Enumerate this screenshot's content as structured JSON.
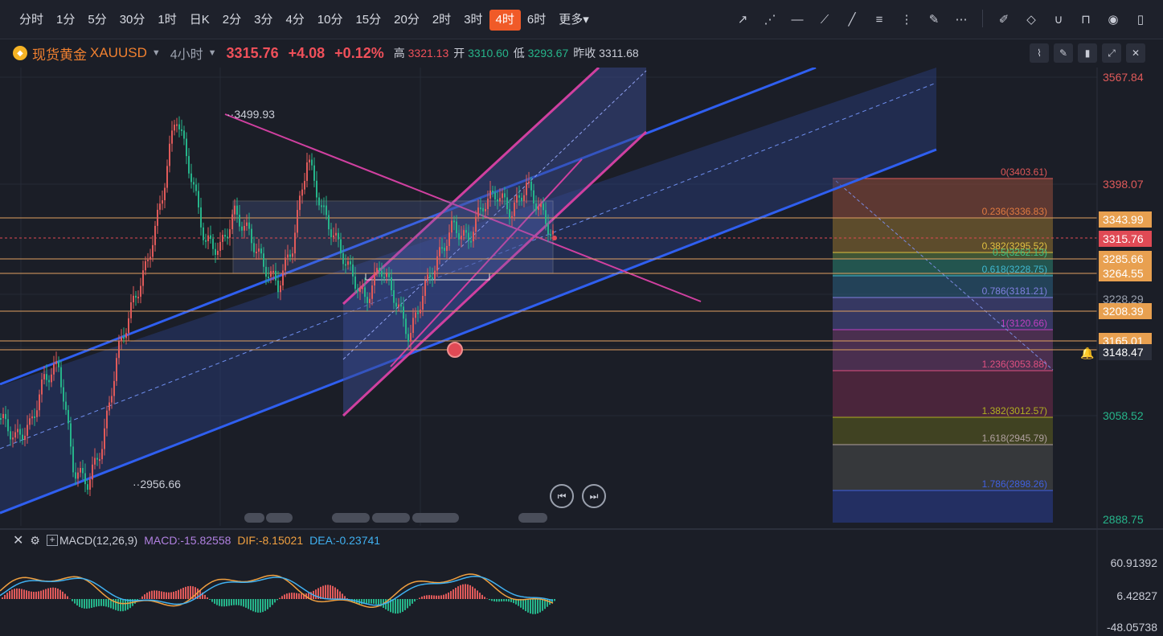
{
  "toolbar": {
    "periods": [
      "分时",
      "1分",
      "5分",
      "30分",
      "1时",
      "日K",
      "2分",
      "3分",
      "4分",
      "10分",
      "15分",
      "20分",
      "2时",
      "3时",
      "4时",
      "6时",
      "更多"
    ],
    "active_period": "4时",
    "more_caret": "▾"
  },
  "info": {
    "instrument": "现货黄金",
    "symbol": "XAUUSD",
    "timeframe": "4小时",
    "price": "3315.76",
    "change": "+4.08",
    "change_pct": "+0.12%",
    "high_label": "高",
    "high": "3321.13",
    "open_label": "开",
    "open": "3310.60",
    "low_label": "低",
    "low": "3293.67",
    "prev_label": "昨收",
    "prev": "3311.68"
  },
  "price_axis": {
    "ticks": [
      "3567.84",
      "3398.07",
      "3228.29",
      "3058.52",
      "2888.75"
    ],
    "tags": [
      {
        "label": "3343.99",
        "color": "#e8a050"
      },
      {
        "label": "3315.76",
        "color": "#e04a55"
      },
      {
        "label": "3285.66",
        "color": "#e8a050"
      },
      {
        "label": "3264.55",
        "color": "#e8a050"
      },
      {
        "label": "3208.39",
        "color": "#e8a050"
      },
      {
        "label": "3165.01",
        "color": "#e8a050"
      },
      {
        "label": "3148.47",
        "color": "#2b2f3b"
      }
    ]
  },
  "annotations": {
    "high_mark": "3499.93",
    "low_mark": "2956.66"
  },
  "fibonacci": [
    {
      "label": "0(3403.61)",
      "color": "#e05858"
    },
    {
      "label": "0.236(3336.83)",
      "color": "#e07a40"
    },
    {
      "label": "0.382(3295.52)",
      "color": "#e0c040"
    },
    {
      "label": "0.5(3262.13)",
      "color": "#40c080"
    },
    {
      "label": "0.618(3228.75)",
      "color": "#40b8d0"
    },
    {
      "label": "0.786(3181.21)",
      "color": "#8080e0"
    },
    {
      "label": "1(3120.66)",
      "color": "#c040c0"
    },
    {
      "label": "1.236(3053.88)",
      "color": "#e05080"
    },
    {
      "label": "1.382(3012.57)",
      "color": "#b0b020"
    },
    {
      "label": "1.618(2945.79)",
      "color": "#b0a0a0"
    },
    {
      "label": "1.786(2898.26)",
      "color": "#4060e0"
    }
  ],
  "macd": {
    "name": "MACD(12,26,9)",
    "macd_label": "MACD:-15.82558",
    "dif_label": "DIF:-8.15021",
    "dea_label": "DEA:-0.23741",
    "ticks": [
      "60.91392",
      "6.42827",
      "-48.05738"
    ],
    "colors": {
      "macd": "#b080e0",
      "dif": "#f0a040",
      "dea": "#40b0f0"
    }
  },
  "colors": {
    "up": "#e05a5a",
    "down": "#26b48a",
    "bg": "#1b1e27",
    "channel": "#3060e0",
    "magenta": "#d040a0"
  }
}
